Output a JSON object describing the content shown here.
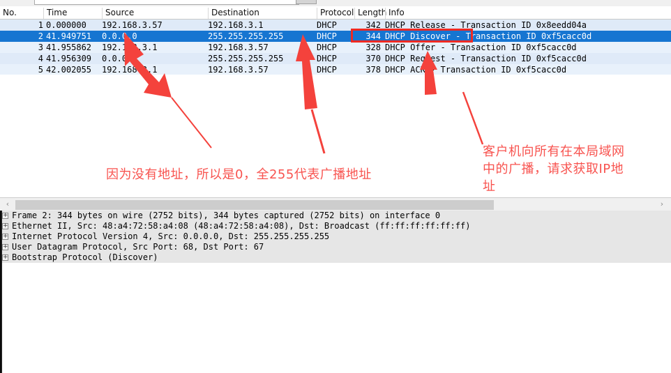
{
  "app": {
    "name": "Wireshark packet list"
  },
  "filter": {
    "value": "",
    "placeholder": "",
    "button_label": ""
  },
  "packet_list": {
    "columns": [
      {
        "key": "no",
        "label": "No."
      },
      {
        "key": "time",
        "label": "Time"
      },
      {
        "key": "src",
        "label": "Source"
      },
      {
        "key": "dst",
        "label": "Destination"
      },
      {
        "key": "proto",
        "label": "Protocol"
      },
      {
        "key": "len",
        "label": "Length"
      },
      {
        "key": "info",
        "label": "Info"
      }
    ],
    "rows": [
      {
        "no": "1",
        "time": "0.000000",
        "src": "192.168.3.57",
        "dst": "192.168.3.1",
        "proto": "DHCP",
        "len": "342",
        "info": "DHCP Release  - Transaction ID 0x8eedd04a",
        "selected": false
      },
      {
        "no": "2",
        "time": "41.949751",
        "src": "0.0.0.0",
        "dst": "255.255.255.255",
        "proto": "DHCP",
        "len": "344",
        "info": "DHCP Discover - Transaction ID 0xf5cacc0d",
        "selected": true
      },
      {
        "no": "3",
        "time": "41.955862",
        "src": "192.168.3.1",
        "dst": "192.168.3.57",
        "proto": "DHCP",
        "len": "328",
        "info": "DHCP Offer    - Transaction ID 0xf5cacc0d",
        "selected": false
      },
      {
        "no": "4",
        "time": "41.956309",
        "src": "0.0.0.0",
        "dst": "255.255.255.255",
        "proto": "DHCP",
        "len": "370",
        "info": "DHCP Request  - Transaction ID 0xf5cacc0d",
        "selected": false
      },
      {
        "no": "5",
        "time": "42.002055",
        "src": "192.168.3.1",
        "dst": "192.168.3.57",
        "proto": "DHCP",
        "len": "378",
        "info": "DHCP ACK      - Transaction ID 0xf5cacc0d",
        "selected": false
      }
    ]
  },
  "scrollbar": {
    "left_arrow": "‹",
    "right_arrow": "›"
  },
  "packet_detail": {
    "expander": "+",
    "rows": [
      {
        "label": "Frame 2: 344 bytes on wire (2752 bits), 344 bytes captured (2752 bits) on interface 0"
      },
      {
        "label": "Ethernet II, Src: 48:a4:72:58:a4:08 (48:a4:72:58:a4:08), Dst: Broadcast (ff:ff:ff:ff:ff:ff)"
      },
      {
        "label": "Internet Protocol Version 4, Src: 0.0.0.0, Dst: 255.255.255.255"
      },
      {
        "label": "User Datagram Protocol, Src Port: 68, Dst Port: 67"
      },
      {
        "label": "Bootstrap Protocol (Discover)"
      }
    ]
  },
  "annotations": {
    "color": "#f8534f",
    "box_color": "#ee2a23",
    "note_broadcast": "因为没有地址，所以是0，全255代表广播地址",
    "note_discover_line1": "客户机向所有在本局域网",
    "note_discover_line2": "中的广播，请求获取IP地",
    "note_discover_line3": "址"
  }
}
